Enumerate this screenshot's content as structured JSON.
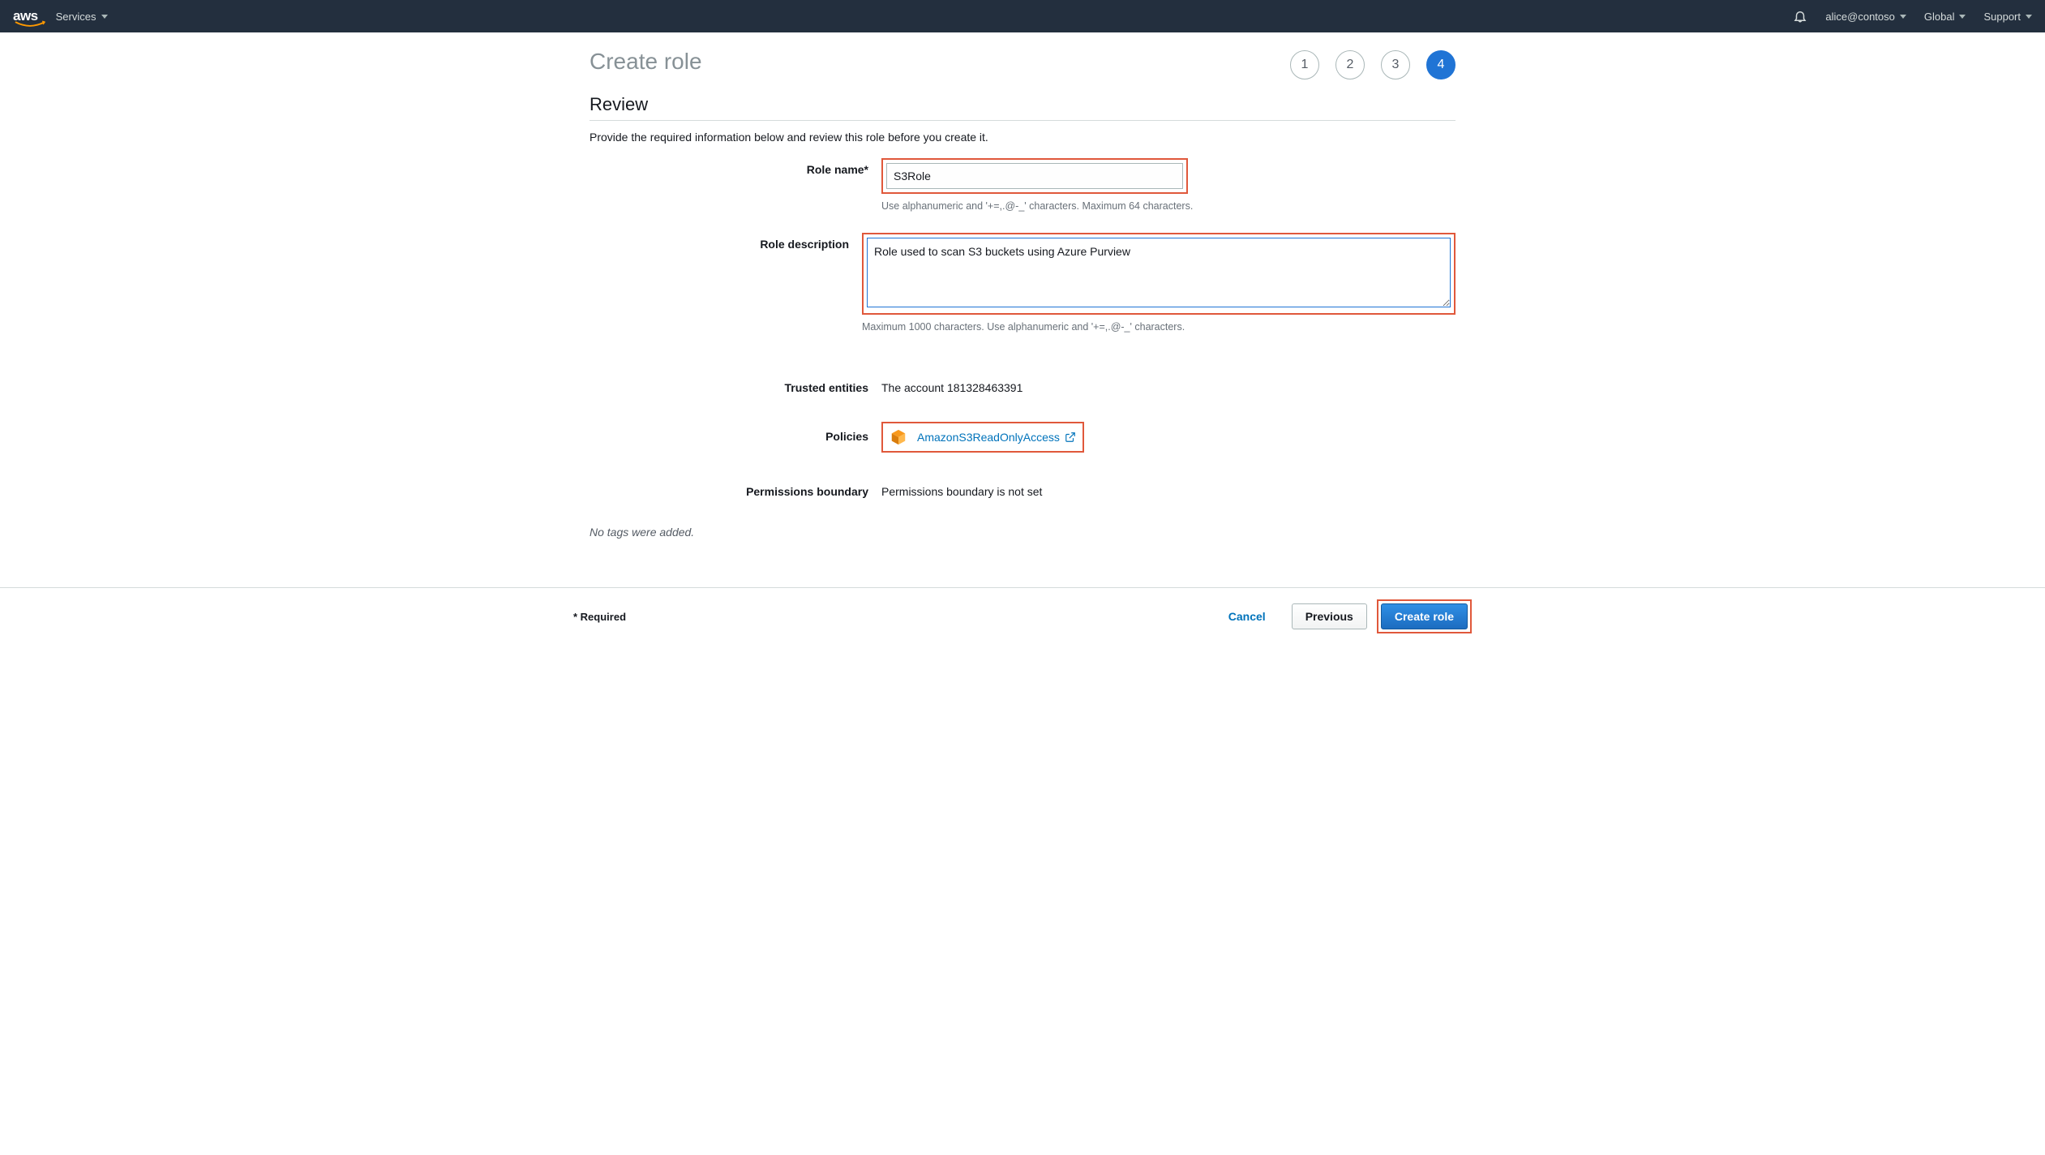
{
  "nav": {
    "logo_text": "aws",
    "services": "Services",
    "user": "alice@contoso",
    "region": "Global",
    "support": "Support"
  },
  "page": {
    "title": "Create role",
    "steps": [
      "1",
      "2",
      "3",
      "4"
    ],
    "active_step_index": 3,
    "section_title": "Review",
    "section_desc": "Provide the required information below and review this role before you create it."
  },
  "form": {
    "role_name_label": "Role name*",
    "role_name_value": "S3Role",
    "role_name_help": "Use alphanumeric and '+=,.@-_' characters. Maximum 64 characters.",
    "role_desc_label": "Role description",
    "role_desc_value": "Role used to scan S3 buckets using Azure Purview",
    "role_desc_help": "Maximum 1000 characters. Use alphanumeric and '+=,.@-_' characters.",
    "trusted_label": "Trusted entities",
    "trusted_value": "The account 181328463391",
    "policies_label": "Policies",
    "policy_link_text": "AmazonS3ReadOnlyAccess",
    "boundary_label": "Permissions boundary",
    "boundary_value": "Permissions boundary is not set",
    "tags_note": "No tags were added."
  },
  "footer": {
    "required": "* Required",
    "cancel": "Cancel",
    "previous": "Previous",
    "create": "Create role"
  },
  "colors": {
    "highlight_border": "#e0583b",
    "primary_button": "#2074d5",
    "link": "#0073bb"
  }
}
